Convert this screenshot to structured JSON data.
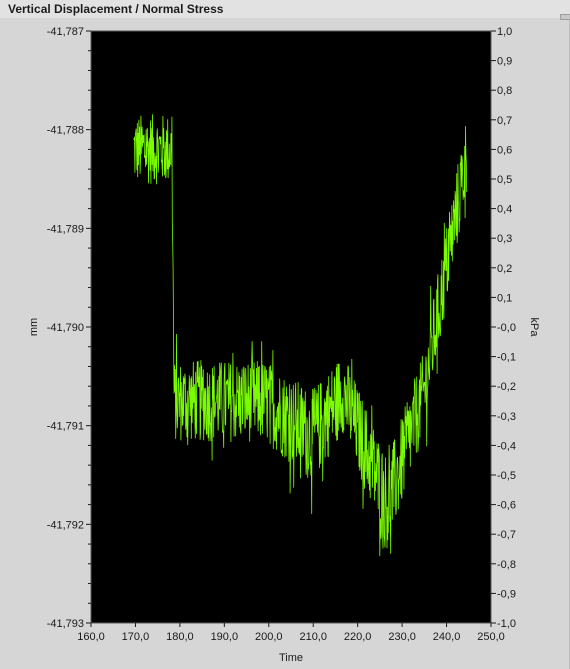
{
  "window": {
    "title": "Vertical Displacement / Normal Stress"
  },
  "chart_data": {
    "type": "line",
    "title": "Vertical Displacement / Normal Stress",
    "xlabel": "Time",
    "ylabel": "mm",
    "y2label": "kPa",
    "xlim": [
      160,
      250
    ],
    "ylim": [
      -41.793,
      -41.787
    ],
    "y2lim": [
      -1.0,
      1.0
    ],
    "x_ticks": [
      "160,0",
      "170,0",
      "180,0",
      "190,0",
      "200,0",
      "210,0",
      "220,0",
      "230,0",
      "240,0",
      "250,0"
    ],
    "y_ticks": [
      "-41,787",
      "-41,788",
      "-41,789",
      "-41,790",
      "-41,791",
      "-41,792",
      "-41,793"
    ],
    "y2_ticks": [
      "1,0",
      "0,9",
      "0,8",
      "0,7",
      "0,6",
      "0,5",
      "0,4",
      "0,3",
      "0,2",
      "0,1",
      "-0,0",
      "-0,1",
      "-0,2",
      "-0,3",
      "-0,4",
      "-0,5",
      "-0,6",
      "-0,7",
      "-0,8",
      "-0,9",
      "-1,0"
    ],
    "grid": false,
    "background": "#000000",
    "series": [
      {
        "color": "#7cfc00",
        "axis": "right",
        "x": [
          169.6,
          178.2,
          178.7,
          199.3,
          209.8,
          216.7,
          226.8,
          234.9,
          244.7
        ],
        "y": [
          0.6,
          0.6,
          -0.25,
          -0.25,
          -0.37,
          -0.22,
          -0.6,
          -0.22,
          0.6
        ],
        "noise_amplitude": [
          0.12,
          0.12,
          0.14,
          0.14,
          0.16,
          0.14,
          0.16,
          0.14,
          0.14
        ]
      }
    ]
  },
  "colors": {
    "plot_background": "#000000",
    "trace": "#7cfc00",
    "panel": "#d6d6d6"
  }
}
